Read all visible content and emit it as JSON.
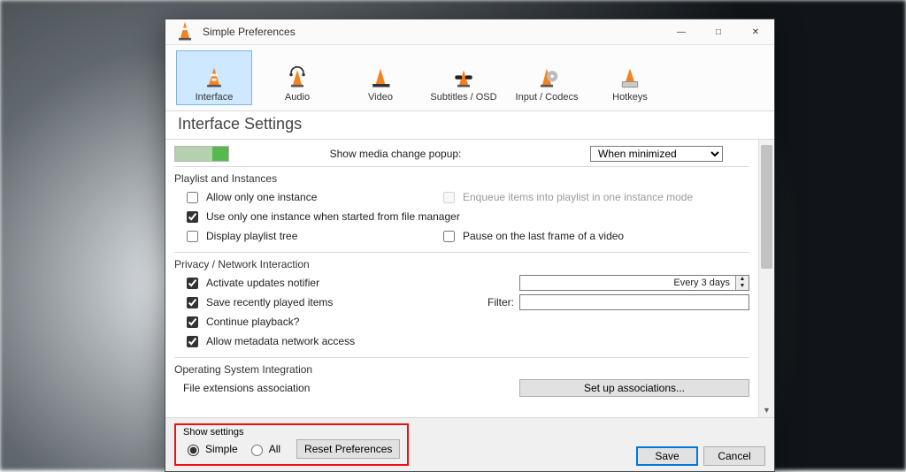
{
  "window": {
    "title": "Simple Preferences"
  },
  "categories": [
    {
      "id": "interface",
      "label": "Interface"
    },
    {
      "id": "audio",
      "label": "Audio"
    },
    {
      "id": "video",
      "label": "Video"
    },
    {
      "id": "subtitles",
      "label": "Subtitles / OSD"
    },
    {
      "id": "codecs",
      "label": "Input / Codecs"
    },
    {
      "id": "hotkeys",
      "label": "Hotkeys"
    }
  ],
  "page_title": "Interface Settings",
  "media_popup": {
    "label": "Show media change popup:",
    "value": "When minimized"
  },
  "playlist_group": {
    "title": "Playlist and Instances",
    "allow_one": {
      "label": "Allow only one instance",
      "checked": false
    },
    "one_from_fm": {
      "label": "Use only one instance when started from file manager",
      "checked": true
    },
    "display_tree": {
      "label": "Display playlist tree",
      "checked": false
    },
    "enqueue": {
      "label": "Enqueue items into playlist in one instance mode",
      "checked": false
    },
    "pause_last": {
      "label": "Pause on the last frame of a video",
      "checked": false
    }
  },
  "privacy_group": {
    "title": "Privacy / Network Interaction",
    "updates": {
      "label": "Activate updates notifier",
      "checked": true
    },
    "update_freq": "Every 3 days",
    "save_recent": {
      "label": "Save recently played items",
      "checked": true
    },
    "filter_label": "Filter:",
    "filter_value": "",
    "continue": {
      "label": "Continue playback?",
      "checked": true
    },
    "metadata": {
      "label": "Allow metadata network access",
      "checked": true
    }
  },
  "os_group": {
    "title": "Operating System Integration",
    "assoc_label": "File extensions association",
    "assoc_button": "Set up associations..."
  },
  "footer": {
    "show_title": "Show settings",
    "simple": "Simple",
    "all": "All",
    "reset": "Reset Preferences",
    "save": "Save",
    "cancel": "Cancel"
  }
}
